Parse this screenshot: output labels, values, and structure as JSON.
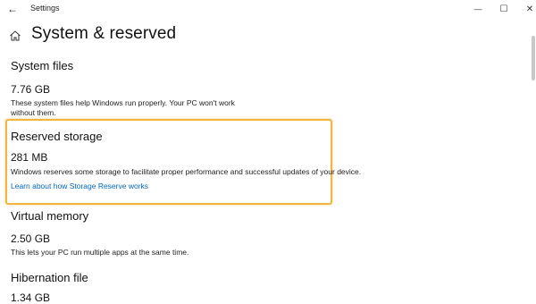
{
  "window": {
    "title": "Settings",
    "back_glyph": "←",
    "minimize_glyph": "—",
    "maximize_glyph": "☐",
    "close_glyph": "✕"
  },
  "page": {
    "title": "System & reserved",
    "home_icon": "home-icon"
  },
  "sections": {
    "system_files": {
      "title": "System files",
      "size": "7.76 GB",
      "description_line1": "These system files help Windows run properly. Your PC won't work",
      "description_line2": "without them."
    },
    "reserved_storage": {
      "title": "Reserved storage",
      "size": "281 MB",
      "description": "Windows reserves some storage to facilitate proper performance and successful updates of your device.",
      "link": "Learn about how Storage Reserve works"
    },
    "virtual_memory": {
      "title": "Virtual memory",
      "size": "2.50 GB",
      "description": "This lets your PC run multiple apps at the same time."
    },
    "hibernation_file": {
      "title": "Hibernation file",
      "size": "1.34 GB"
    }
  },
  "colors": {
    "accent_link": "#0067c0",
    "highlight": "#f0b542"
  }
}
